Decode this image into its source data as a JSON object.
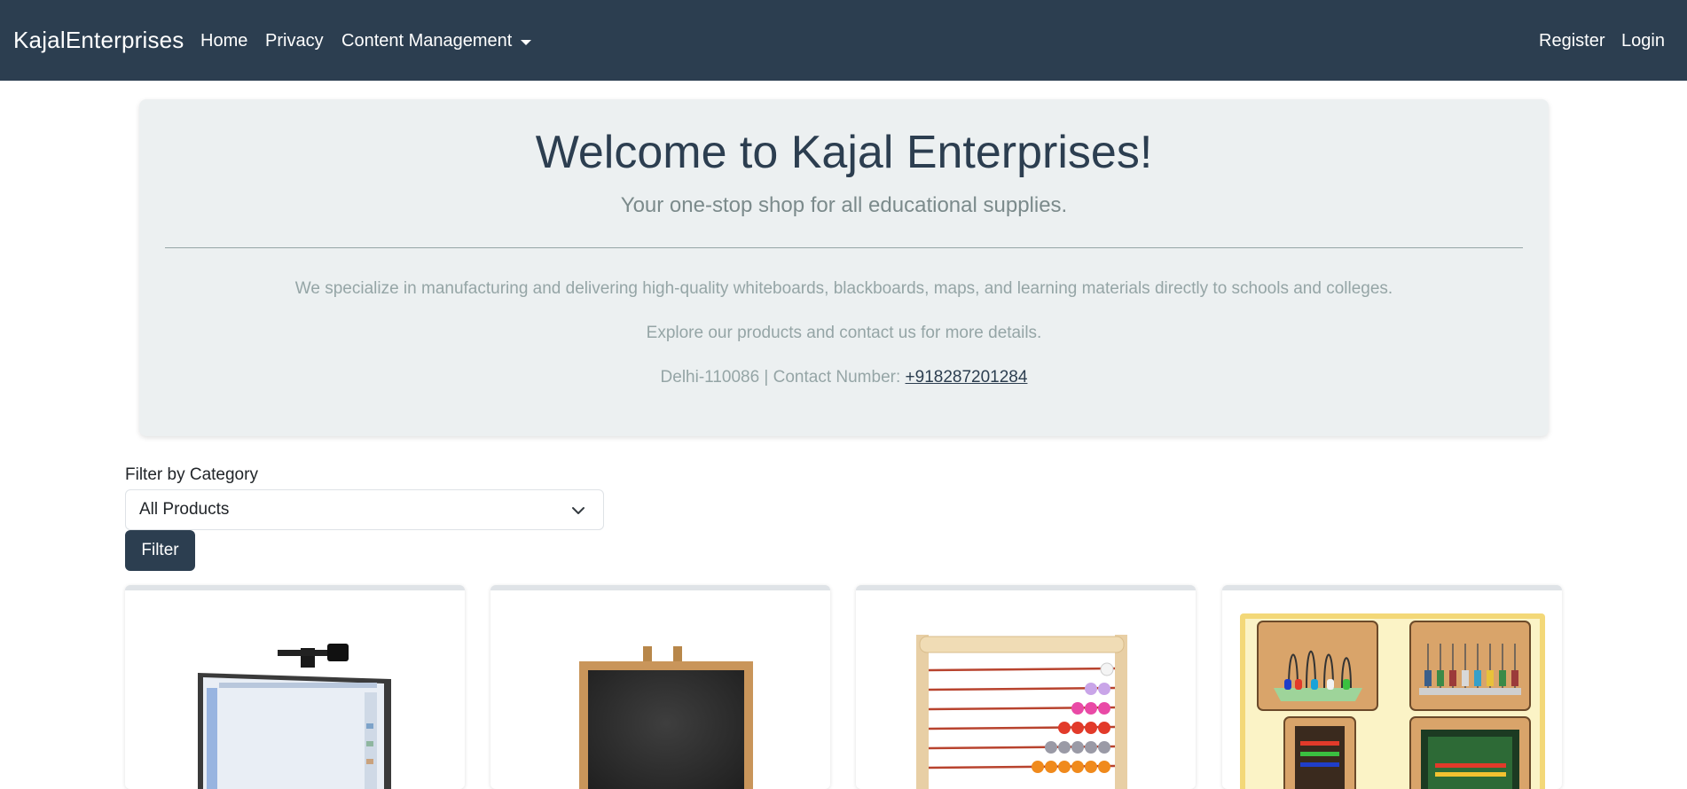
{
  "navbar": {
    "brand": "KajalEnterprises",
    "links": [
      "Home",
      "Privacy",
      "Content Management"
    ],
    "right_links": [
      "Register",
      "Login"
    ]
  },
  "hero": {
    "title": "Welcome to Kajal Enterprises!",
    "lead": "Your one-stop shop for all educational supplies.",
    "paragraphs": [
      "We specialize in manufacturing and delivering high-quality whiteboards, blackboards, maps, and learning materials directly to schools and colleges.",
      "Explore our products and contact us for more details."
    ],
    "contact_prefix": "Delhi-110086 | Contact Number: ",
    "phone": "+918287201284"
  },
  "filter": {
    "label": "Filter by Category",
    "selected": "All Products",
    "button": "Filter"
  },
  "products": [
    {
      "image": "smart-whiteboard-image"
    },
    {
      "image": "blackboard-image"
    },
    {
      "image": "abacus-image"
    },
    {
      "image": "abacus-set-image"
    }
  ],
  "colors": {
    "navbar": "#2c3e50",
    "hero_bg": "#ecf0f1",
    "muted_text": "#95a5a6",
    "button": "#2c3e50"
  }
}
